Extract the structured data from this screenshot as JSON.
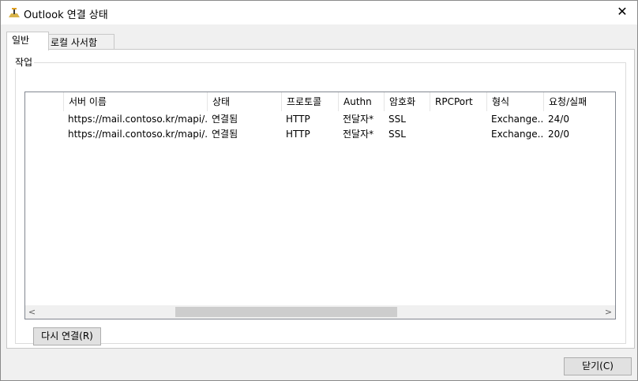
{
  "window": {
    "title": "Outlook 연결 상태",
    "close_glyph": "✕"
  },
  "tabs": [
    {
      "label": "일반",
      "active": true
    },
    {
      "label": "로컬 사서함",
      "active": false
    }
  ],
  "group": {
    "label": "작업"
  },
  "table": {
    "columns": [
      "서버 이름",
      "상태",
      "프로토콜",
      "Authn",
      "암호화",
      "RPCPort",
      "형식",
      "요청/실패"
    ],
    "rows": [
      [
        "https://mail.contoso.kr/mapi/...",
        "연결됨",
        "HTTP",
        "전달자*",
        "SSL",
        "",
        "Exchange...",
        "24/0"
      ],
      [
        "https://mail.contoso.kr/mapi/...",
        "연결됨",
        "HTTP",
        "전달자*",
        "SSL",
        "",
        "Exchange...",
        "20/0"
      ]
    ]
  },
  "scrollbar": {
    "left_arrow": "<",
    "right_arrow": ">"
  },
  "buttons": {
    "reconnect": "다시 연결(R)",
    "close": "닫기(C)"
  },
  "icons": {
    "title_icon": "outlook-connection-icon"
  }
}
